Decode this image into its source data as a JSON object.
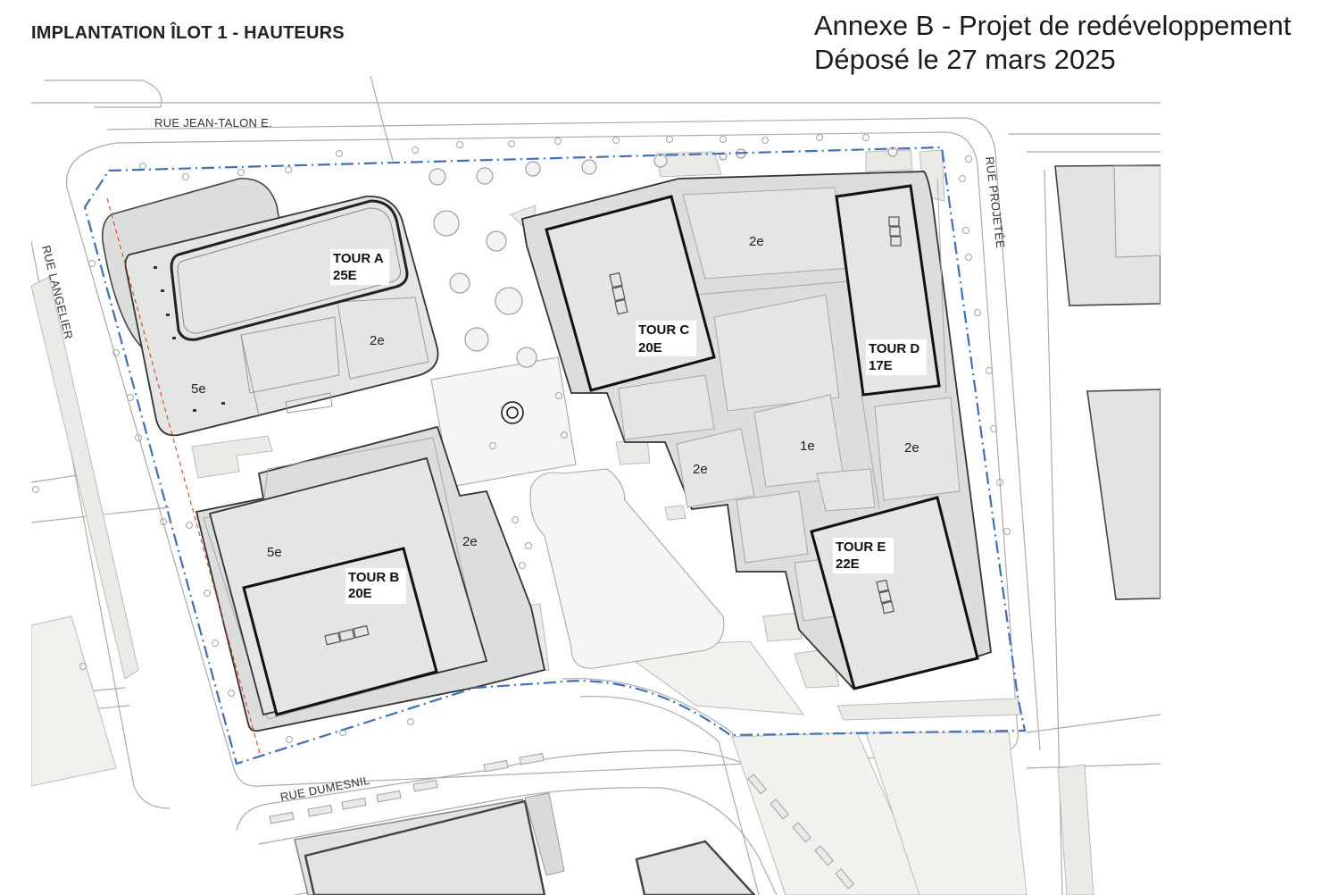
{
  "header": {
    "title": "IMPLANTATION ÎLOT 1 - HAUTEURS",
    "annex_line1": "Annexe B - Projet de redéveloppement",
    "annex_line2": "Déposé le 27 mars 2025"
  },
  "streets": {
    "north": "RUE JEAN-TALON E.",
    "west": "RUE LANGELIER",
    "east": "RUE PROJETÉE",
    "south": "RUE DUMESNIL"
  },
  "towers": [
    {
      "name": "TOUR A",
      "height": "25E"
    },
    {
      "name": "TOUR B",
      "height": "20E"
    },
    {
      "name": "TOUR C",
      "height": "20E"
    },
    {
      "name": "TOUR D",
      "height": "17E"
    },
    {
      "name": "TOUR E",
      "height": "22E"
    }
  ],
  "levels": {
    "a_podium_low": "5e",
    "a_podium_east": "2e",
    "b_podium_west": "5e",
    "b_podium_east": "2e",
    "c_north": "2e",
    "c_south": "2e",
    "center": "1e",
    "d_south": "2e"
  },
  "colors": {
    "building_fill": "#e4e5e5",
    "podium_fill": "#d9dadb",
    "property_line": "#3f6fb5",
    "setback_line": "#d9431f",
    "pavement": "#ececea"
  }
}
